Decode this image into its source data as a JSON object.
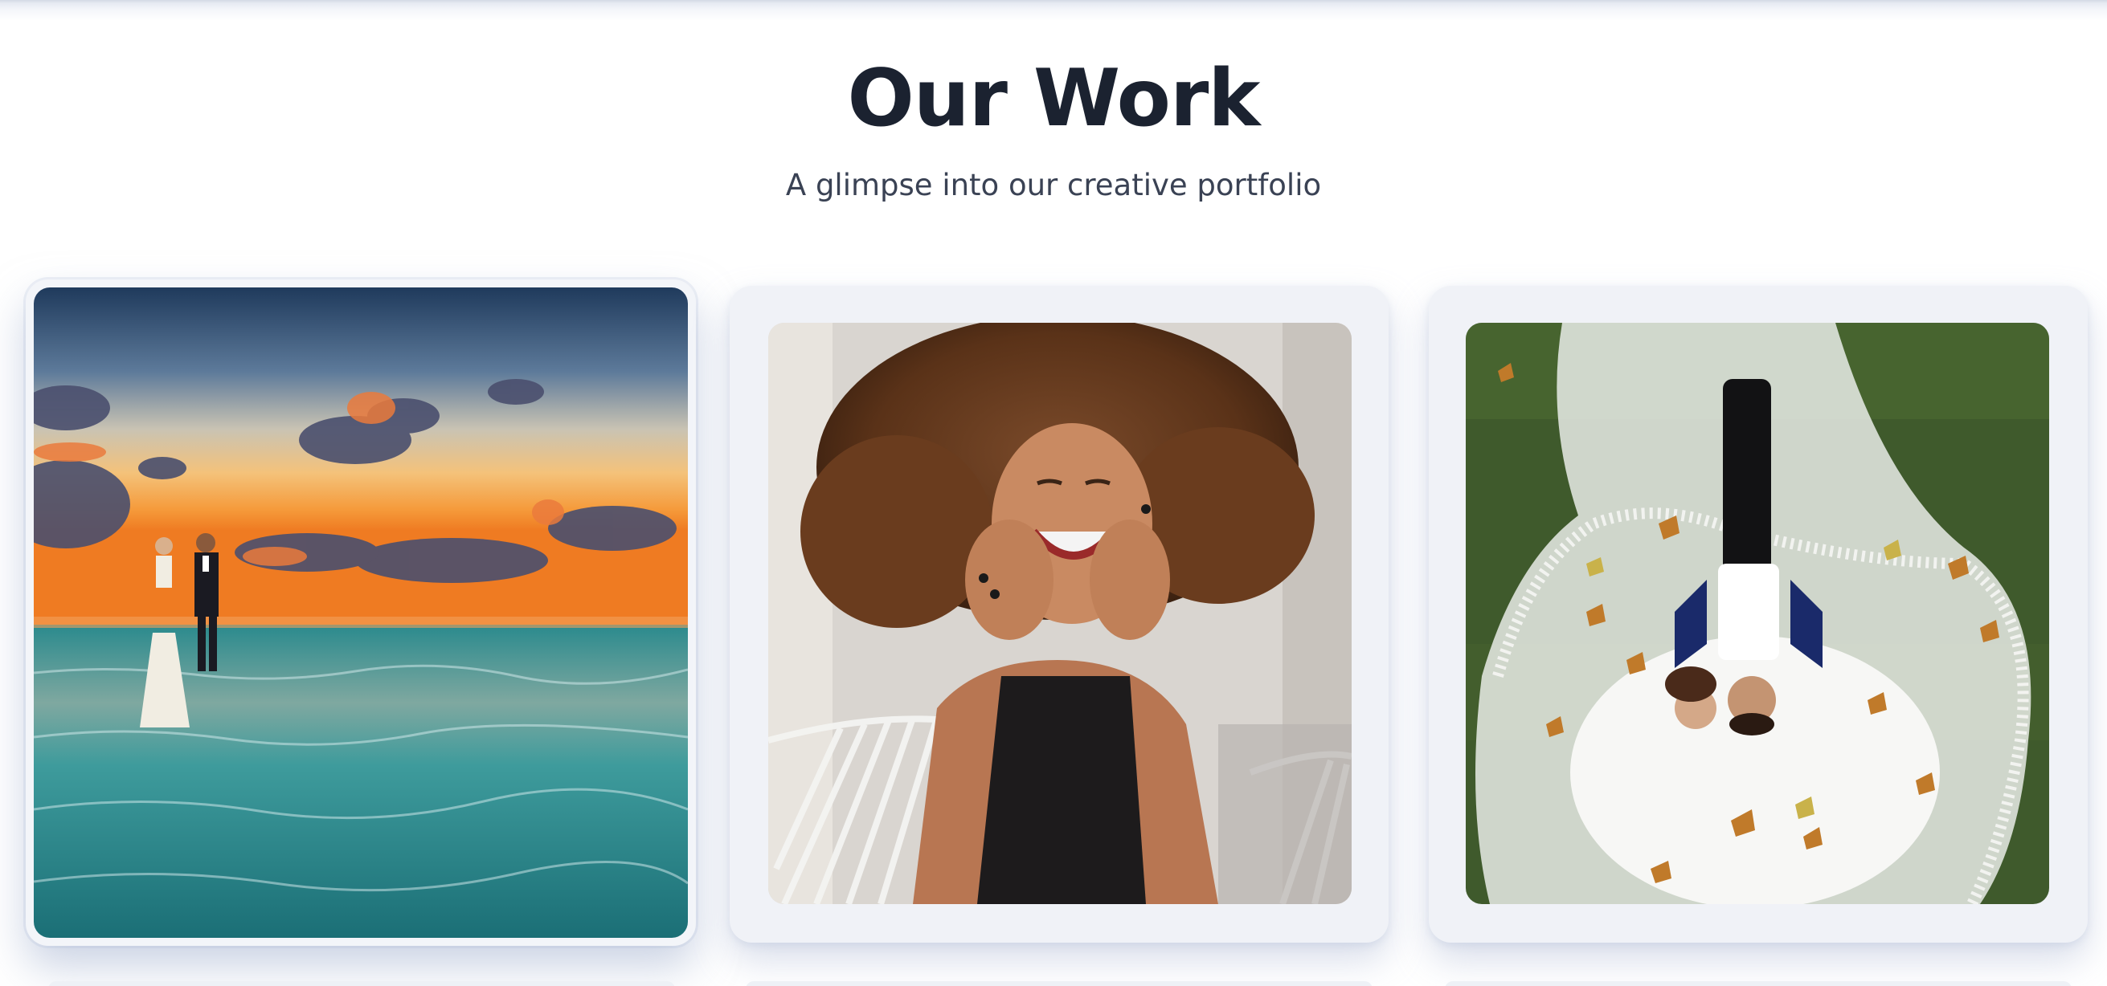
{
  "section": {
    "title": "Our Work",
    "subtitle": "A glimpse into our creative portfolio"
  },
  "gallery": {
    "items": [
      {
        "subject": "couple-walking-beach-sunset-photo"
      },
      {
        "subject": "smiling-woman-curly-hair-photo"
      },
      {
        "subject": "bride-groom-lying-autumn-leaves-photo"
      }
    ]
  }
}
